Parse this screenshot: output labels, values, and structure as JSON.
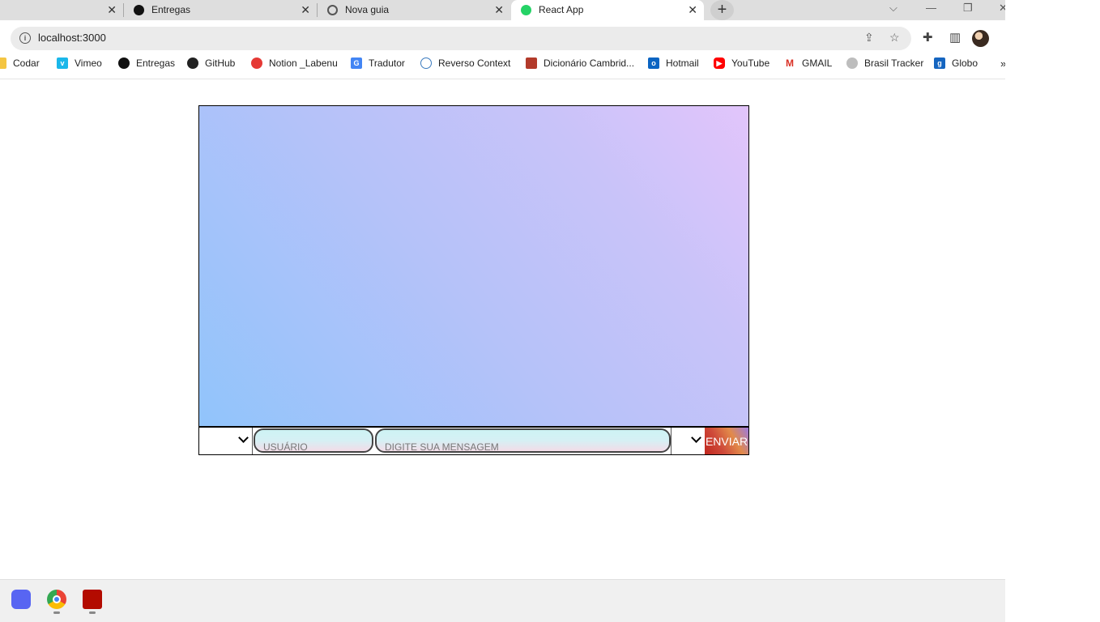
{
  "browser": {
    "tabs": [
      {
        "title": "",
        "close": "✕"
      },
      {
        "title": "Entregas",
        "close": "✕"
      },
      {
        "title": "Nova guia",
        "close": "✕"
      },
      {
        "title": "React App",
        "close": "✕",
        "active": true
      }
    ],
    "new_tab": "+",
    "window_controls": {
      "tab_search": "⌵",
      "minimize": "—",
      "restore": "❐",
      "close": "✕"
    },
    "url": "localhost:3000",
    "bookmarks": [
      {
        "label": "Codar",
        "icon": "folder-icon",
        "color": "#f4c542"
      },
      {
        "label": "Vimeo",
        "icon": "vimeo-icon",
        "color": "#1ab7ea"
      },
      {
        "label": "Entregas",
        "icon": "circle-icon",
        "color": "#111111"
      },
      {
        "label": "GitHub",
        "icon": "github-icon",
        "color": "#222222"
      },
      {
        "label": "Notion _Labenu",
        "icon": "apple-icon",
        "color": "#e53935"
      },
      {
        "label": "Tradutor",
        "icon": "translate-icon",
        "color": "#4285f4"
      },
      {
        "label": "Reverso Context",
        "icon": "reverso-icon",
        "color": "#3b7bbf"
      },
      {
        "label": "Dicionário Cambrid...",
        "icon": "cambridge-icon",
        "color": "#b23a2a"
      },
      {
        "label": "Hotmail",
        "icon": "outlook-icon",
        "color": "#0a64c2"
      },
      {
        "label": "YouTube",
        "icon": "youtube-icon",
        "color": "#ff0000"
      },
      {
        "label": "GMAIL",
        "icon": "gmail-icon",
        "color": "#d93025"
      },
      {
        "label": "Brasil Tracker",
        "icon": "lock-icon",
        "color": "#9e9e9e"
      },
      {
        "label": "Globo",
        "icon": "globo-icon",
        "color": "#1565c0"
      }
    ],
    "more_bookmarks": "»"
  },
  "chat": {
    "user_placeholder": "USUÁRIO",
    "message_placeholder": "DIGITE SUA MENSAGEM",
    "send_label": "ENVIAR"
  },
  "taskbar": {
    "apps": [
      {
        "name": "discord-icon"
      },
      {
        "name": "chrome-icon"
      },
      {
        "name": "acrobat-icon"
      }
    ]
  }
}
